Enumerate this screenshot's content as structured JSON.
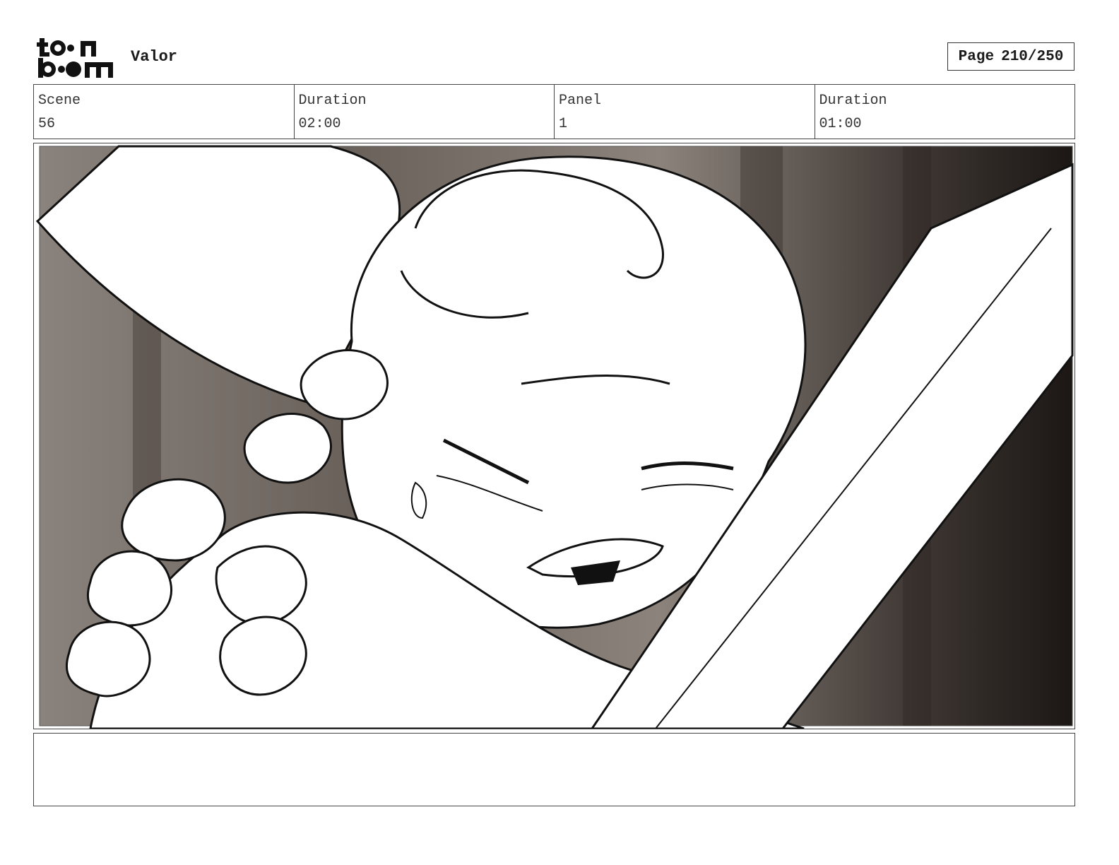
{
  "header": {
    "logo_text": "toonboom",
    "project_title": "Valor",
    "page": {
      "label": "Page",
      "current": "210",
      "total": "250",
      "display": "210/250"
    }
  },
  "info": {
    "scene_label": "Scene",
    "scene_value": "56",
    "scene_duration_label": "Duration",
    "scene_duration_value": "02:00",
    "panel_label": "Panel",
    "panel_value": "1",
    "panel_duration_label": "Duration",
    "panel_duration_value": "01:00"
  },
  "notes": {
    "text": ""
  }
}
